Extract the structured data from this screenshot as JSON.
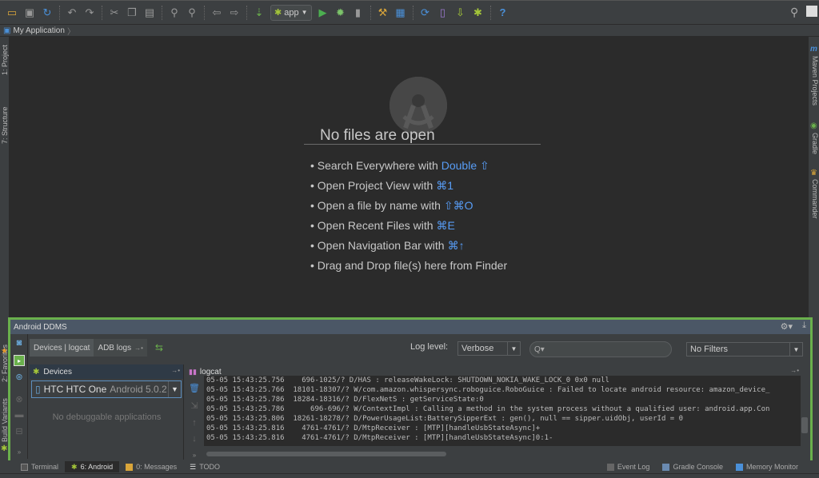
{
  "toolbar": {
    "icons": [
      "open-folder-icon",
      "save-icon",
      "sync-icon",
      "undo-icon",
      "redo-icon",
      "cut-icon",
      "copy-icon",
      "paste-icon",
      "find-icon",
      "replace-icon",
      "back-icon",
      "forward-icon",
      "make-project-icon"
    ],
    "run_config": "app",
    "run_icons": [
      "run-icon",
      "debug-icon",
      "attach-debugger-icon",
      "project-structure-icon",
      "settings-icon",
      "sdk-manager-icon",
      "avd-manager-icon",
      "sync-gradle-icon",
      "android-device-monitor-icon",
      "help-icon"
    ]
  },
  "breadcrumb": {
    "project": "My Application"
  },
  "left_tabs": [
    "1: Project",
    "7: Structure",
    "2: Favorites",
    "Build Variants"
  ],
  "right_tabs": [
    "Maven Projects",
    "Gradle",
    "Commander"
  ],
  "editor": {
    "empty_title": "No files are open",
    "tips": [
      {
        "text": "Search Everywhere with",
        "key": "Double ⇧"
      },
      {
        "text": "Open Project View with",
        "key": "⌘1"
      },
      {
        "text": "Open a file by name with",
        "key": "⇧⌘O"
      },
      {
        "text": "Open Recent Files with",
        "key": "⌘E"
      },
      {
        "text": "Open Navigation Bar with",
        "key": "⌘↑"
      },
      {
        "text": "Drag and Drop file(s) here from Finder",
        "key": ""
      }
    ]
  },
  "ddms": {
    "title": "Android DDMS",
    "tabs": [
      "Devices | logcat",
      "ADB logs"
    ],
    "log_level_label": "Log level:",
    "log_level": "Verbose",
    "search_placeholder": "Q▾",
    "filter": "No Filters",
    "devices_header": "Devices",
    "device_name": "HTC HTC One",
    "device_os": "Android 5.0.2",
    "no_apps": "No debuggable applications",
    "logcat_header": "logcat",
    "log_lines": [
      "05-05 15:43:25.756    696-1025/? D/HAS : releaseWakeLock: SHUTDOWN_NOKIA_WAKE_LOCK_0 0x0 null",
      "05-05 15:43:25.766  18101-18307/? W/com.amazon.whispersync.roboguice.RoboGuice : Failed to locate android resource: amazon_device_",
      "05-05 15:43:25.786  18284-18316/? D/FlexNetS : getServiceState:0",
      "05-05 15:43:25.786      696-696/? W/ContextImpl : Calling a method in the system process without a qualified user: android.app.Con",
      "05-05 15:43:25.806  18261-18278/? D/PowerUsageList:BatterySipperExt : gen(), null == sipper.uidObj, userId = 0",
      "05-05 15:43:25.816    4761-4761/? D/MtpReceiver : [MTP][handleUsbStateAsync]+",
      "05-05 15:43:25.816    4761-4761/? D/MtpReceiver : [MTP][handleUsbStateAsync]0:1-"
    ]
  },
  "bottom_tabs": [
    {
      "label": "Terminal",
      "selected": false
    },
    {
      "label": "6: Android",
      "selected": true
    },
    {
      "label": "0: Messages",
      "selected": false
    },
    {
      "label": "TODO",
      "selected": false
    }
  ],
  "bottom_right_tabs": [
    "Event Log",
    "Gradle Console",
    "Memory Monitor"
  ],
  "colors": {
    "accent_link": "#589df6",
    "highlight_border": "#6ab04c",
    "panel_title": "#4b5766"
  }
}
